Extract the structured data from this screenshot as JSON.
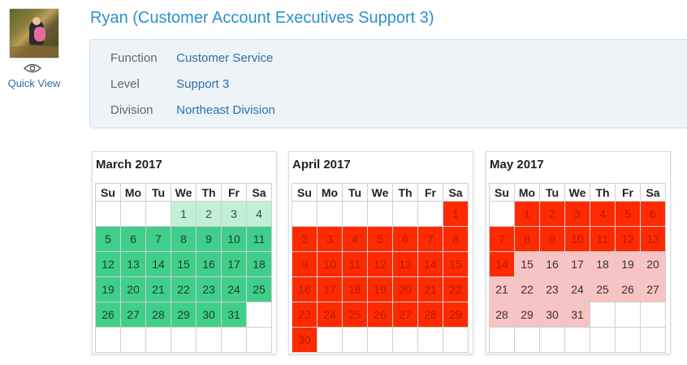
{
  "profile": {
    "title": "Ryan (Customer Account Executives Support 3)",
    "quick_view": "Quick View",
    "avatar_icon": "photo-avatar",
    "eye_icon": "eye-icon"
  },
  "details": {
    "rows": [
      {
        "label": "Function",
        "value": "Customer Service"
      },
      {
        "label": "Level",
        "value": "Support 3"
      },
      {
        "label": "Division",
        "value": "Northeast Division"
      }
    ]
  },
  "weekdays": [
    "Su",
    "Mo",
    "Tu",
    "We",
    "Th",
    "Fr",
    "Sa"
  ],
  "colors": {
    "green": "#3fcf8a",
    "light_green": "#c2f0d6",
    "red": "#ff2a00",
    "pink": "#f8c3c3",
    "link": "#2b8fd0"
  },
  "calendars": [
    {
      "title": "March 2017",
      "weeks": [
        [
          {
            "d": "",
            "s": "empty"
          },
          {
            "d": "",
            "s": "empty"
          },
          {
            "d": "",
            "s": "empty"
          },
          {
            "d": "1",
            "s": "light-green"
          },
          {
            "d": "2",
            "s": "light-green"
          },
          {
            "d": "3",
            "s": "light-green"
          },
          {
            "d": "4",
            "s": "light-green"
          }
        ],
        [
          {
            "d": "5",
            "s": "green"
          },
          {
            "d": "6",
            "s": "green"
          },
          {
            "d": "7",
            "s": "green"
          },
          {
            "d": "8",
            "s": "green"
          },
          {
            "d": "9",
            "s": "green"
          },
          {
            "d": "10",
            "s": "green"
          },
          {
            "d": "11",
            "s": "green"
          }
        ],
        [
          {
            "d": "12",
            "s": "green"
          },
          {
            "d": "13",
            "s": "green"
          },
          {
            "d": "14",
            "s": "green"
          },
          {
            "d": "15",
            "s": "green"
          },
          {
            "d": "16",
            "s": "green"
          },
          {
            "d": "17",
            "s": "green"
          },
          {
            "d": "18",
            "s": "green"
          }
        ],
        [
          {
            "d": "19",
            "s": "green"
          },
          {
            "d": "20",
            "s": "green"
          },
          {
            "d": "21",
            "s": "green"
          },
          {
            "d": "22",
            "s": "green"
          },
          {
            "d": "23",
            "s": "green"
          },
          {
            "d": "24",
            "s": "green"
          },
          {
            "d": "25",
            "s": "green"
          }
        ],
        [
          {
            "d": "26",
            "s": "green"
          },
          {
            "d": "27",
            "s": "green"
          },
          {
            "d": "28",
            "s": "green"
          },
          {
            "d": "29",
            "s": "green"
          },
          {
            "d": "30",
            "s": "green"
          },
          {
            "d": "31",
            "s": "green"
          },
          {
            "d": "",
            "s": "empty"
          }
        ],
        [
          {
            "d": "",
            "s": "empty"
          },
          {
            "d": "",
            "s": "empty"
          },
          {
            "d": "",
            "s": "empty"
          },
          {
            "d": "",
            "s": "empty"
          },
          {
            "d": "",
            "s": "empty"
          },
          {
            "d": "",
            "s": "empty"
          },
          {
            "d": "",
            "s": "empty"
          }
        ]
      ]
    },
    {
      "title": "April 2017",
      "weeks": [
        [
          {
            "d": "",
            "s": "empty"
          },
          {
            "d": "",
            "s": "empty"
          },
          {
            "d": "",
            "s": "empty"
          },
          {
            "d": "",
            "s": "empty"
          },
          {
            "d": "",
            "s": "empty"
          },
          {
            "d": "",
            "s": "empty"
          },
          {
            "d": "1",
            "s": "red"
          }
        ],
        [
          {
            "d": "2",
            "s": "red"
          },
          {
            "d": "3",
            "s": "red"
          },
          {
            "d": "4",
            "s": "red"
          },
          {
            "d": "5",
            "s": "red"
          },
          {
            "d": "6",
            "s": "red"
          },
          {
            "d": "7",
            "s": "red"
          },
          {
            "d": "8",
            "s": "red"
          }
        ],
        [
          {
            "d": "9",
            "s": "red"
          },
          {
            "d": "10",
            "s": "red"
          },
          {
            "d": "11",
            "s": "red"
          },
          {
            "d": "12",
            "s": "red"
          },
          {
            "d": "13",
            "s": "red"
          },
          {
            "d": "14",
            "s": "red"
          },
          {
            "d": "15",
            "s": "red"
          }
        ],
        [
          {
            "d": "16",
            "s": "red"
          },
          {
            "d": "17",
            "s": "red"
          },
          {
            "d": "18",
            "s": "red"
          },
          {
            "d": "19",
            "s": "red"
          },
          {
            "d": "20",
            "s": "red"
          },
          {
            "d": "21",
            "s": "red"
          },
          {
            "d": "22",
            "s": "red"
          }
        ],
        [
          {
            "d": "23",
            "s": "red"
          },
          {
            "d": "24",
            "s": "red"
          },
          {
            "d": "25",
            "s": "red"
          },
          {
            "d": "26",
            "s": "red"
          },
          {
            "d": "27",
            "s": "red"
          },
          {
            "d": "28",
            "s": "red"
          },
          {
            "d": "29",
            "s": "red"
          }
        ],
        [
          {
            "d": "30",
            "s": "red"
          },
          {
            "d": "",
            "s": "empty"
          },
          {
            "d": "",
            "s": "empty"
          },
          {
            "d": "",
            "s": "empty"
          },
          {
            "d": "",
            "s": "empty"
          },
          {
            "d": "",
            "s": "empty"
          },
          {
            "d": "",
            "s": "empty"
          }
        ]
      ]
    },
    {
      "title": "May 2017",
      "weeks": [
        [
          {
            "d": "",
            "s": "empty"
          },
          {
            "d": "1",
            "s": "red"
          },
          {
            "d": "2",
            "s": "red"
          },
          {
            "d": "3",
            "s": "red"
          },
          {
            "d": "4",
            "s": "red"
          },
          {
            "d": "5",
            "s": "red"
          },
          {
            "d": "6",
            "s": "red"
          }
        ],
        [
          {
            "d": "7",
            "s": "red"
          },
          {
            "d": "8",
            "s": "red"
          },
          {
            "d": "9",
            "s": "red"
          },
          {
            "d": "10",
            "s": "red"
          },
          {
            "d": "11",
            "s": "red"
          },
          {
            "d": "12",
            "s": "red"
          },
          {
            "d": "13",
            "s": "red"
          }
        ],
        [
          {
            "d": "14",
            "s": "red"
          },
          {
            "d": "15",
            "s": "pink"
          },
          {
            "d": "16",
            "s": "pink"
          },
          {
            "d": "17",
            "s": "pink"
          },
          {
            "d": "18",
            "s": "pink"
          },
          {
            "d": "19",
            "s": "pink"
          },
          {
            "d": "20",
            "s": "pink"
          }
        ],
        [
          {
            "d": "21",
            "s": "pink"
          },
          {
            "d": "22",
            "s": "pink"
          },
          {
            "d": "23",
            "s": "pink"
          },
          {
            "d": "24",
            "s": "pink"
          },
          {
            "d": "25",
            "s": "pink"
          },
          {
            "d": "26",
            "s": "pink"
          },
          {
            "d": "27",
            "s": "pink"
          }
        ],
        [
          {
            "d": "28",
            "s": "pink"
          },
          {
            "d": "29",
            "s": "pink"
          },
          {
            "d": "30",
            "s": "pink"
          },
          {
            "d": "31",
            "s": "pink"
          },
          {
            "d": "",
            "s": "empty"
          },
          {
            "d": "",
            "s": "empty"
          },
          {
            "d": "",
            "s": "empty"
          }
        ],
        [
          {
            "d": "",
            "s": "empty"
          },
          {
            "d": "",
            "s": "empty"
          },
          {
            "d": "",
            "s": "empty"
          },
          {
            "d": "",
            "s": "empty"
          },
          {
            "d": "",
            "s": "empty"
          },
          {
            "d": "",
            "s": "empty"
          },
          {
            "d": "",
            "s": "empty"
          }
        ]
      ]
    }
  ]
}
